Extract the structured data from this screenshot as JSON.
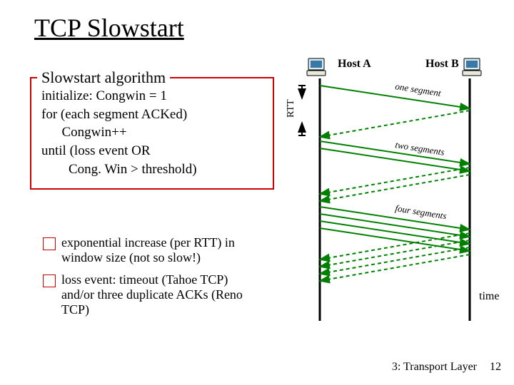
{
  "title": "TCP Slowstart",
  "algo": {
    "legend": "Slowstart algorithm",
    "body": "initialize: Congwin = 1\nfor (each segment ACKed)\n      Congwin++\nuntil (loss event OR\n        Cong. Win > threshold)"
  },
  "bullets": [
    "exponential increase (per RTT) in window size (not so slow!)",
    "loss event: timeout (Tahoe TCP) and/or three duplicate ACKs (Reno TCP)"
  ],
  "diagram": {
    "host_a": "Host A",
    "host_b": "Host B",
    "rtt": "RTT",
    "seg1": "one segment",
    "seg2": "two segments",
    "seg4": "four segments",
    "time": "time"
  },
  "footer": {
    "chapter": "3: Transport Layer",
    "page": "12"
  },
  "icons": {
    "computer": "computer-icon"
  }
}
